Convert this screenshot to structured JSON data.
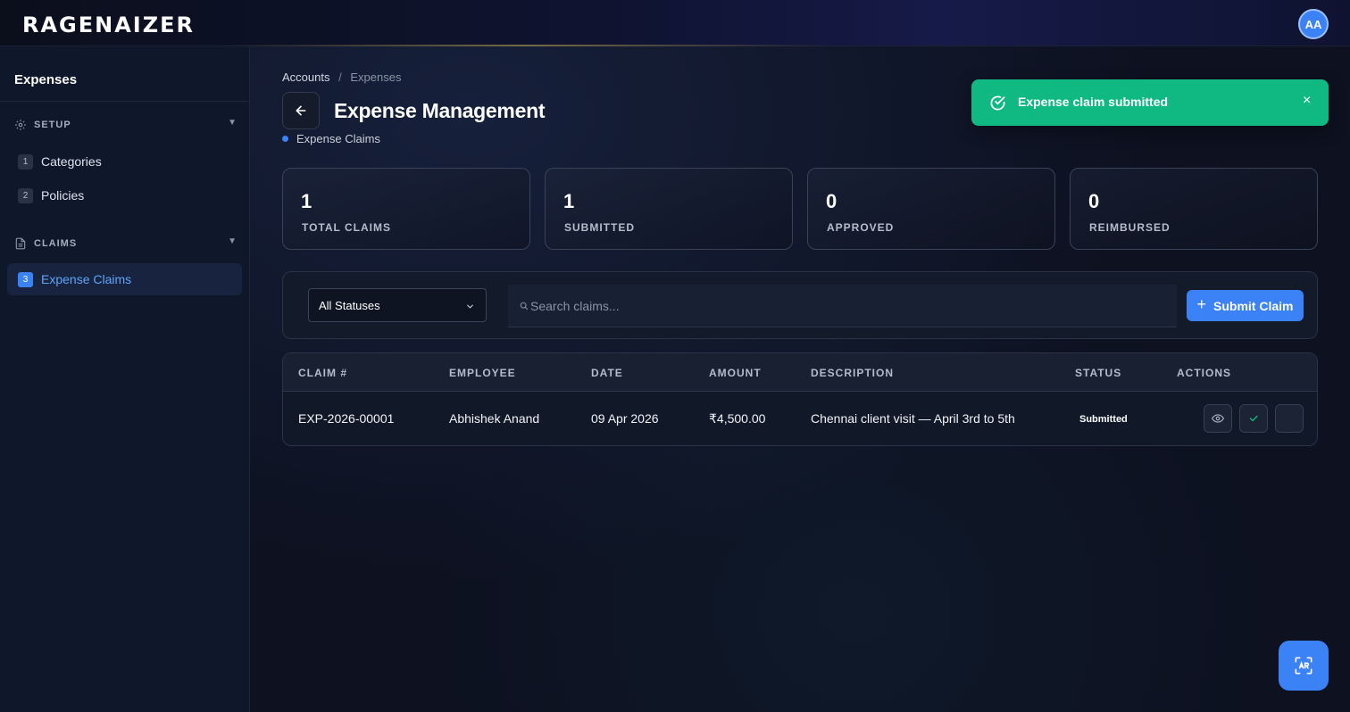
{
  "app": {
    "logo": "RAGENAIZER",
    "user_initials": "AA"
  },
  "sidebar": {
    "title": "Expenses",
    "sections": [
      {
        "label": "SETUP",
        "icon": "gear-icon"
      },
      {
        "label": "CLAIMS",
        "icon": "document-icon"
      }
    ],
    "items": [
      {
        "num": "1",
        "label": "Categories"
      },
      {
        "num": "2",
        "label": "Policies"
      },
      {
        "num": "3",
        "label": "Expense Claims"
      }
    ]
  },
  "breadcrumb": {
    "parent": "Accounts",
    "separator": "/",
    "current": "Expenses"
  },
  "page": {
    "title": "Expense Management",
    "subtitle": "Expense Claims"
  },
  "stats": [
    {
      "value": "1",
      "label": "TOTAL CLAIMS"
    },
    {
      "value": "1",
      "label": "SUBMITTED"
    },
    {
      "value": "0",
      "label": "APPROVED"
    },
    {
      "value": "0",
      "label": "REIMBURSED"
    }
  ],
  "filters": {
    "status_selected": "All Statuses",
    "search_placeholder": "Search claims...",
    "submit_label": "Submit Claim"
  },
  "table": {
    "columns": [
      "CLAIM #",
      "EMPLOYEE",
      "DATE",
      "AMOUNT",
      "DESCRIPTION",
      "STATUS",
      "ACTIONS"
    ],
    "rows": [
      {
        "claim": "EXP-2026-00001",
        "employee": "Abhishek Anand",
        "date": "09 Apr 2026",
        "amount": "₹4,500.00",
        "description": "Chennai client visit — April 3rd to 5th",
        "status": "Submitted"
      }
    ]
  },
  "toast": {
    "message": "Expense claim submitted",
    "close": "×"
  },
  "colors": {
    "accent": "#3b82f6",
    "success": "#10b981",
    "background": "#0d1120"
  }
}
